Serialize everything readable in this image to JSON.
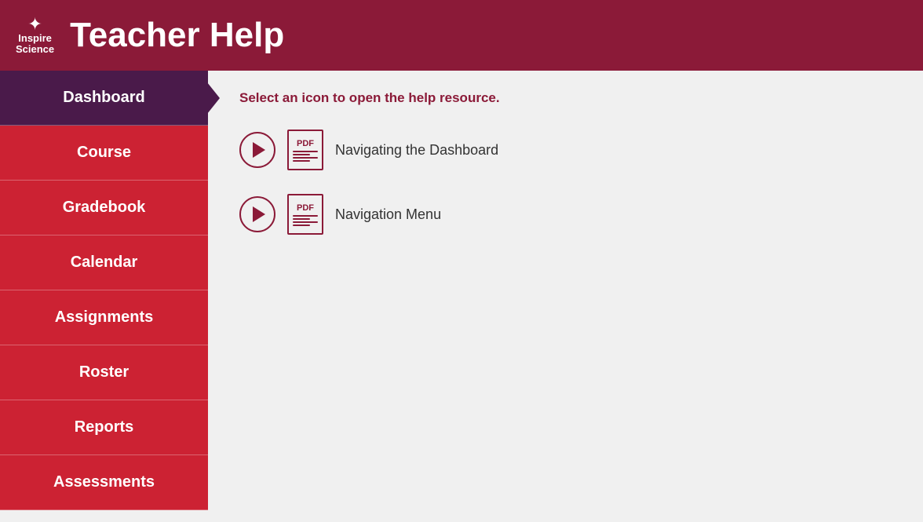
{
  "header": {
    "logo_line1": "Inspire",
    "logo_line2": "Science",
    "logo_icon": "✦",
    "title": "Teacher Help"
  },
  "sidebar": {
    "items": [
      {
        "id": "dashboard",
        "label": "Dashboard",
        "state": "active"
      },
      {
        "id": "course",
        "label": "Course",
        "state": "red"
      },
      {
        "id": "gradebook",
        "label": "Gradebook",
        "state": "red"
      },
      {
        "id": "calendar",
        "label": "Calendar",
        "state": "red"
      },
      {
        "id": "assignments",
        "label": "Assignments",
        "state": "red"
      },
      {
        "id": "roster",
        "label": "Roster",
        "state": "red"
      },
      {
        "id": "reports",
        "label": "Reports",
        "state": "red"
      },
      {
        "id": "assessments",
        "label": "Assessments",
        "state": "red"
      }
    ]
  },
  "content": {
    "instruction": "Select an icon to open the help resource.",
    "help_items": [
      {
        "id": "navigating-dashboard",
        "label": "Navigating the Dashboard"
      },
      {
        "id": "navigation-menu",
        "label": "Navigation Menu"
      }
    ]
  }
}
